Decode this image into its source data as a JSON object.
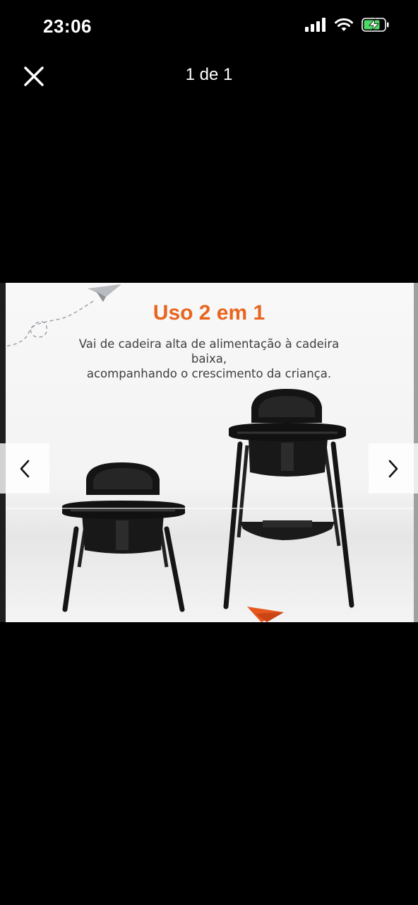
{
  "status_bar": {
    "time": "23:06",
    "icons": [
      "cellular-signal-icon",
      "wifi-icon",
      "battery-charging-icon"
    ],
    "battery_color": "#4cd964"
  },
  "viewer": {
    "counter": "1 de 1",
    "close_icon": "close-icon",
    "prev_icon": "chevron-left-icon",
    "next_icon": "chevron-right-icon"
  },
  "product_image": {
    "headline": "Uso 2 em 1",
    "subtitle_line1": "Vai de cadeira alta de alimentação à cadeira baixa,",
    "subtitle_line2": "acompanhando o crescimento da criança.",
    "headline_color": "#e8651f",
    "decor_icons": [
      "paper-plane-icon",
      "orange-paper-plane-icon"
    ]
  }
}
